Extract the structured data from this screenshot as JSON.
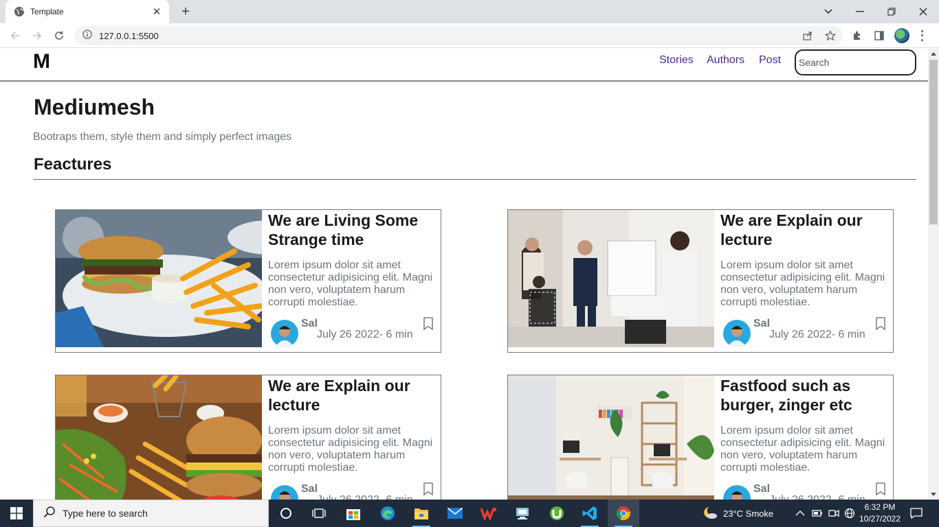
{
  "browser": {
    "tab_title": "Template",
    "url": "127.0.0.1:5500"
  },
  "site": {
    "brand": "M",
    "nav_links": [
      "Stories",
      "Authors",
      "Post"
    ],
    "search_placeholder": "Search",
    "heading": "Mediumesh",
    "lead": "Bootraps them, style them and simply perfect images",
    "section_title": "Feactures"
  },
  "cards": [
    {
      "title": "We are Living Some Strange time",
      "text": "Lorem ipsum dolor sit amet consectetur adipisicing elit. Magni non vero, voluptatem harum corrupti molestiae.",
      "author": "Sal",
      "meta": "July 26 2022- 6 min",
      "image": "burger-fries-photo"
    },
    {
      "title": "We are Explain our lecture",
      "text": "Lorem ipsum dolor sit amet consectetur adipisicing elit. Magni non vero, voluptatem harum corrupti molestiae.",
      "author": "Sal",
      "meta": "July 26 2022- 6 min",
      "image": "office-whiteboard-photo"
    },
    {
      "title": "We are Explain our lecture",
      "text": "Lorem ipsum dolor sit amet consectetur adipisicing elit. Magni non vero, voluptatem harum corrupti molestiae.",
      "author": "Sal",
      "meta": "July 26 2022- 6 min",
      "image": "burger-salad-photo"
    },
    {
      "title": "Fastfood such as burger, zinger etc",
      "text": "Lorem ipsum dolor sit amet consectetur adipisicing elit. Magni non vero, voluptatem harum corrupti molestiae.",
      "author": "Sal",
      "meta": "July 26 2022- 6 min",
      "image": "home-office-photo"
    }
  ],
  "taskbar": {
    "search_text": "Type here to search",
    "weather": "23°C  Smoke",
    "time": "6:32 PM",
    "date": "10/27/2022"
  },
  "colors": {
    "nav_link": "#4b2a8a",
    "muted_text": "#6c757d",
    "taskbar": "#1f2a3a"
  }
}
